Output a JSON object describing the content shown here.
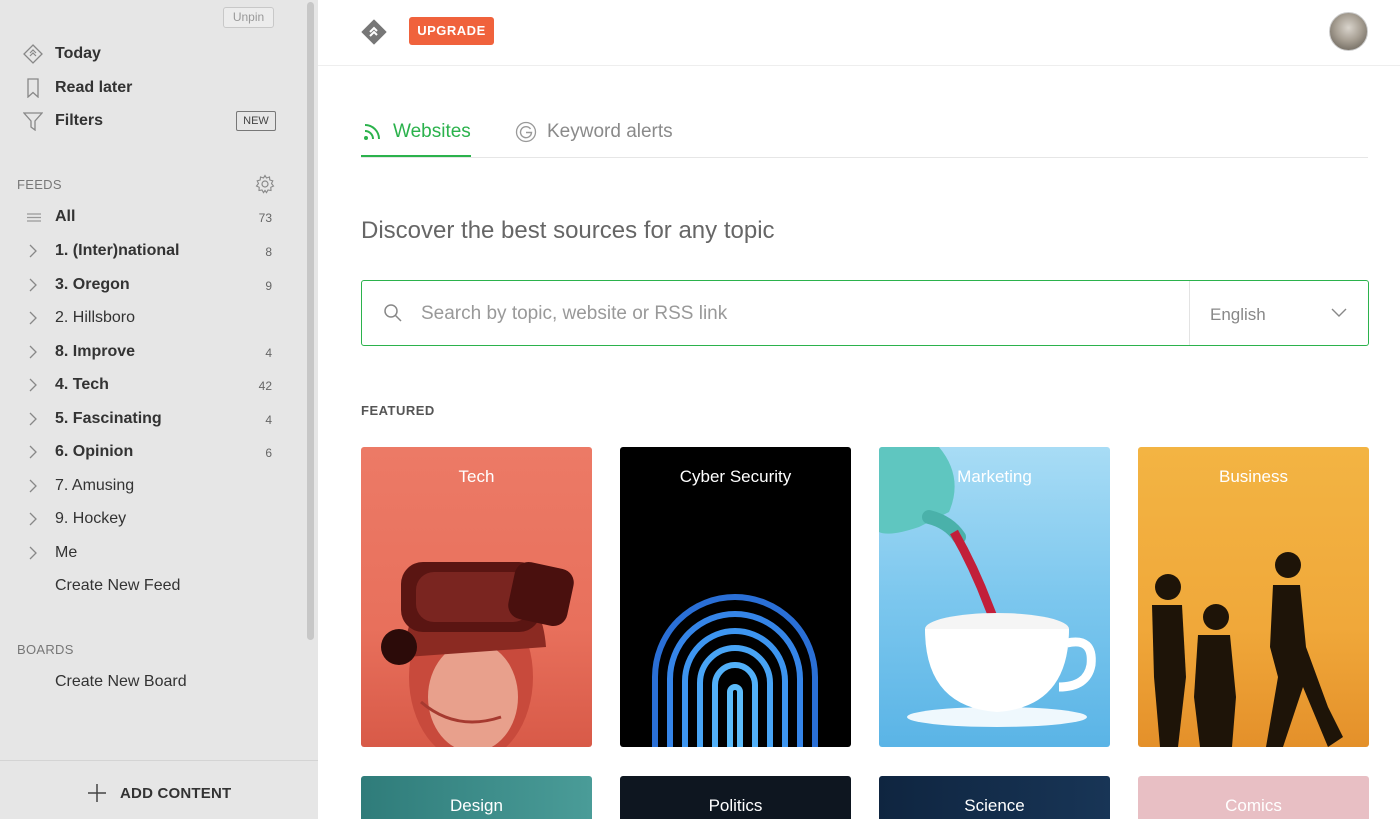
{
  "sidebar": {
    "unpin_label": "Unpin",
    "nav": [
      {
        "label": "Today",
        "icon": "today-icon"
      },
      {
        "label": "Read later",
        "icon": "bookmark-icon"
      },
      {
        "label": "Filters",
        "icon": "filter-icon",
        "badge": "NEW"
      }
    ],
    "feeds_label": "FEEDS",
    "feeds": [
      {
        "label": "All",
        "count": "73",
        "bold": true
      },
      {
        "label": "1. (Inter)national",
        "count": "8",
        "bold": true
      },
      {
        "label": "3. Oregon",
        "count": "9",
        "bold": true
      },
      {
        "label": "2. Hillsboro",
        "count": "",
        "bold": false
      },
      {
        "label": "8. Improve",
        "count": "4",
        "bold": true
      },
      {
        "label": "4. Tech",
        "count": "42",
        "bold": true
      },
      {
        "label": "5. Fascinating",
        "count": "4",
        "bold": true
      },
      {
        "label": "6. Opinion",
        "count": "6",
        "bold": true
      },
      {
        "label": "7. Amusing",
        "count": "",
        "bold": false
      },
      {
        "label": "9. Hockey",
        "count": "",
        "bold": false
      },
      {
        "label": "Me",
        "count": "",
        "bold": false
      }
    ],
    "create_feed": "Create New Feed",
    "boards_label": "BOARDS",
    "create_board": "Create New Board",
    "add_content": "ADD CONTENT"
  },
  "topbar": {
    "upgrade_label": "UPGRADE"
  },
  "tabs": [
    {
      "label": "Websites",
      "icon": "rss-icon",
      "active": true
    },
    {
      "label": "Keyword alerts",
      "icon": "google-icon",
      "active": false
    }
  ],
  "main": {
    "heading": "Discover the best sources for any topic",
    "search_placeholder": "Search by topic, website or RSS link",
    "language": "English",
    "featured_label": "FEATURED"
  },
  "cards": [
    {
      "title": "Tech",
      "color": "#e9705e"
    },
    {
      "title": "Cyber Security",
      "color": "#000000"
    },
    {
      "title": "Marketing",
      "color": "#7cc7ee"
    },
    {
      "title": "Business",
      "color": "#f0a83a"
    }
  ],
  "cards_row2": [
    {
      "title": "Design",
      "color": "#3d8c8a"
    },
    {
      "title": "Politics",
      "color": "#101a26"
    },
    {
      "title": "Science",
      "color": "#112b47"
    },
    {
      "title": "Comics",
      "color": "#e8bfc4"
    }
  ],
  "colors": {
    "accent": "#2bb24c",
    "upgrade": "#f0623c",
    "sidebar_bg": "#e6e6e6"
  }
}
